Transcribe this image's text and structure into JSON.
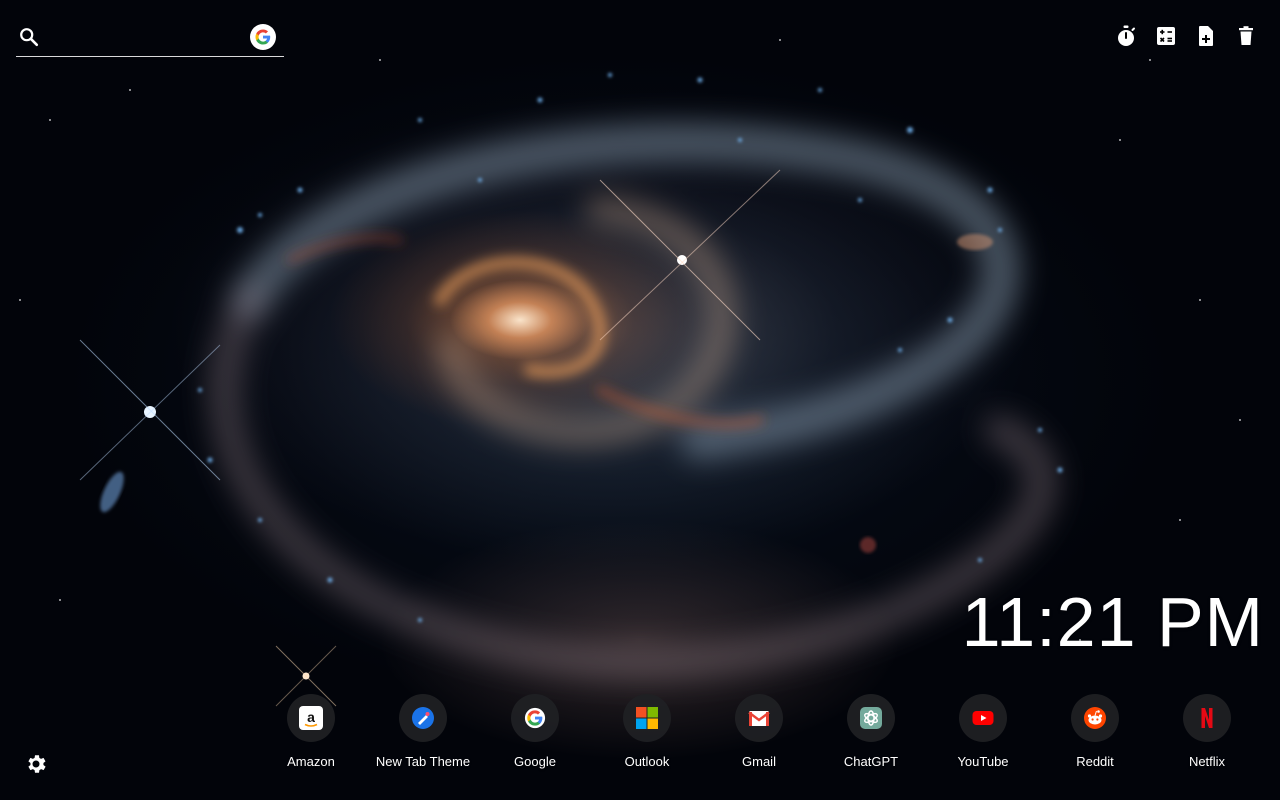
{
  "search": {
    "value": "",
    "placeholder": "",
    "engine_icon": "google-g-icon"
  },
  "toolbar": {
    "items": [
      {
        "icon": "stopwatch-icon"
      },
      {
        "icon": "calculator-icon"
      },
      {
        "icon": "note-add-icon"
      },
      {
        "icon": "trash-icon"
      }
    ]
  },
  "clock": {
    "time": "11:21 PM"
  },
  "shortcuts": [
    {
      "label": "Amazon",
      "icon": "amazon-icon"
    },
    {
      "label": "New Tab Theme",
      "icon": "new-tab-theme-icon"
    },
    {
      "label": "Google",
      "icon": "google-icon"
    },
    {
      "label": "Outlook",
      "icon": "microsoft-icon"
    },
    {
      "label": "Gmail",
      "icon": "gmail-icon"
    },
    {
      "label": "ChatGPT",
      "icon": "chatgpt-icon"
    },
    {
      "label": "YouTube",
      "icon": "youtube-icon"
    },
    {
      "label": "Reddit",
      "icon": "reddit-icon"
    },
    {
      "label": "Netflix",
      "icon": "netflix-icon"
    }
  ],
  "settings": {
    "icon": "gear-icon"
  },
  "colors": {
    "tile_bg": "#202124",
    "text": "#ffffff",
    "youtube_red": "#ff0000",
    "reddit_orange": "#ff4500",
    "netflix_red": "#e50914",
    "chatgpt_green": "#74aa9c"
  }
}
